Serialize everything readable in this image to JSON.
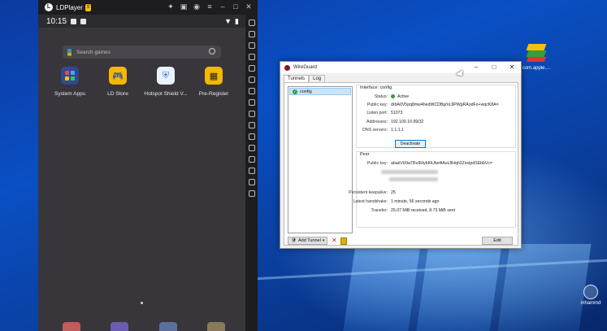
{
  "desktop": {
    "icon_label": "com.apple....",
    "user_label": "mhammd"
  },
  "ldplayer": {
    "title": "LDPlayer",
    "badge": "9",
    "time": "10:15",
    "search_placeholder": "Search games",
    "apps": [
      {
        "label": "System Apps",
        "icon": "system-apps-icon"
      },
      {
        "label": "LD Store",
        "icon": "gamepad-icon"
      },
      {
        "label": "Hotspot Shield V...",
        "icon": "shield-icon"
      },
      {
        "label": "Pre-Register",
        "icon": "calendar-icon"
      }
    ]
  },
  "wireguard": {
    "title": "WireGuard",
    "tabs": [
      "Tunnels",
      "Log"
    ],
    "tunnel": "config",
    "interface": {
      "title": "Interface: config",
      "status_label": "Status:",
      "status": "Active",
      "pubkey_label": "Public key:",
      "pubkey": "drbA0V5pq8mw4hedWCDBg/nL9PWgRAodFo+wqcK8A=",
      "port_label": "Listen port:",
      "port": "51073",
      "addr_label": "Addresses:",
      "addr": "192.100.10.99/32",
      "dns_label": "DNS servers:",
      "dns": "1.1.1.1",
      "deactivate": "Deactivate"
    },
    "peer": {
      "title": "Peer",
      "pubkey_label": "Public key:",
      "pubkey": "abakVtXta7Ru9HybKiUtw4tAsL8Hqh2ZxstpdSEbbVc=",
      "keepalive_label": "Persistent keepalive:",
      "keepalive": "25",
      "handshake_label": "Latest handshake:",
      "handshake": "1 minute, 56 seconds ago",
      "transfer_label": "Transfer:",
      "transfer": "25.07 MiB received, 8.73 MiB sent"
    },
    "add_tunnel": "Add Tunnel",
    "edit": "Edit"
  }
}
